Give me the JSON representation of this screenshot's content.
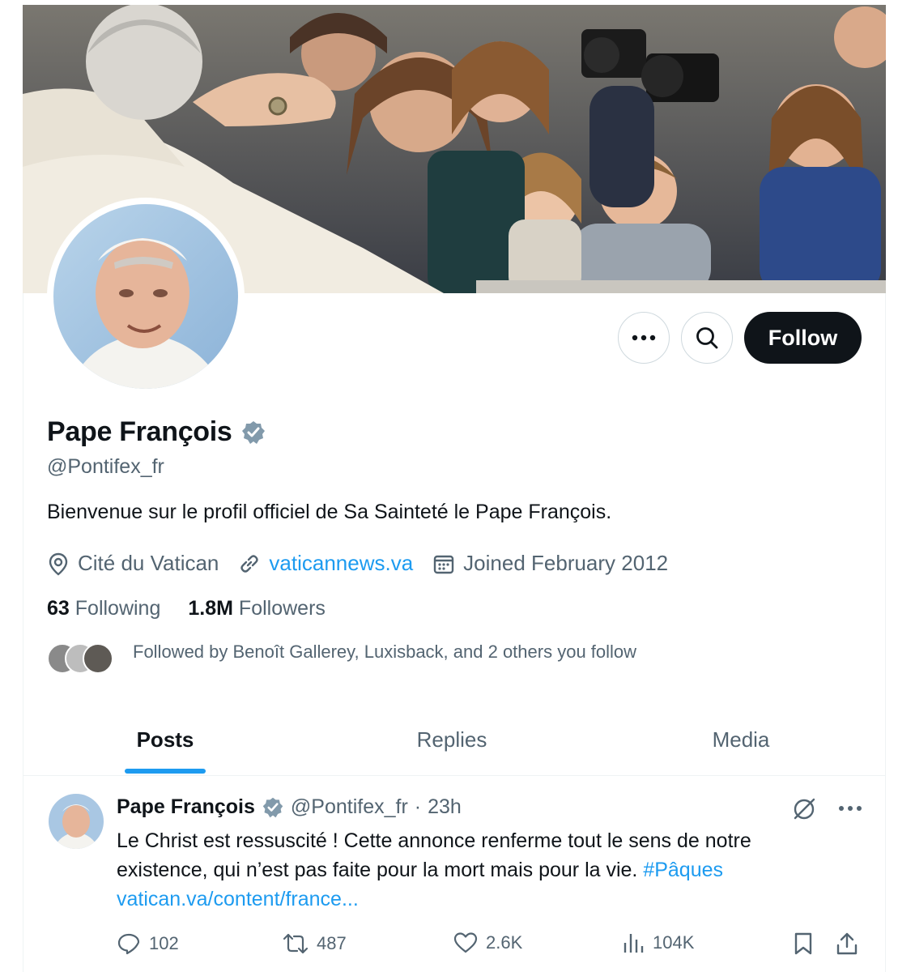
{
  "profile": {
    "name": "Pape François",
    "handle": "@Pontifex_fr",
    "bio": "Bienvenue sur le profil officiel de Sa Sainteté le Pape François.",
    "location": "Cité du Vatican",
    "website": "vaticannews.va",
    "joined": "Joined February 2012",
    "following_count": "63",
    "following_label": "Following",
    "followers_count": "1.8M",
    "followers_label": "Followers",
    "followed_by": "Followed by Benoît Gallerey, Luxisback, and 2 others you follow"
  },
  "actions": {
    "follow_label": "Follow",
    "more_icon": "more-horizontal-icon",
    "search_icon": "search-icon"
  },
  "tabs": [
    {
      "label": "Posts",
      "active": true
    },
    {
      "label": "Replies",
      "active": false
    },
    {
      "label": "Media",
      "active": false
    }
  ],
  "post": {
    "author": "Pape François",
    "handle": "@Pontifex_fr",
    "separator": "·",
    "time": "23h",
    "text": "Le Christ est ressuscité ! Cette annonce renferme tout le sens de notre existence, qui n’est pas faite pour la mort mais pour la vie.",
    "hashtag": "#Pâques",
    "link": "vatican.va/content/france...",
    "replies": "102",
    "reposts": "487",
    "likes": "2.6K",
    "views": "104K"
  },
  "colors": {
    "accent": "#1d9bf0",
    "text": "#0f1419",
    "muted": "#536471",
    "follow_bg": "#0f1419"
  }
}
